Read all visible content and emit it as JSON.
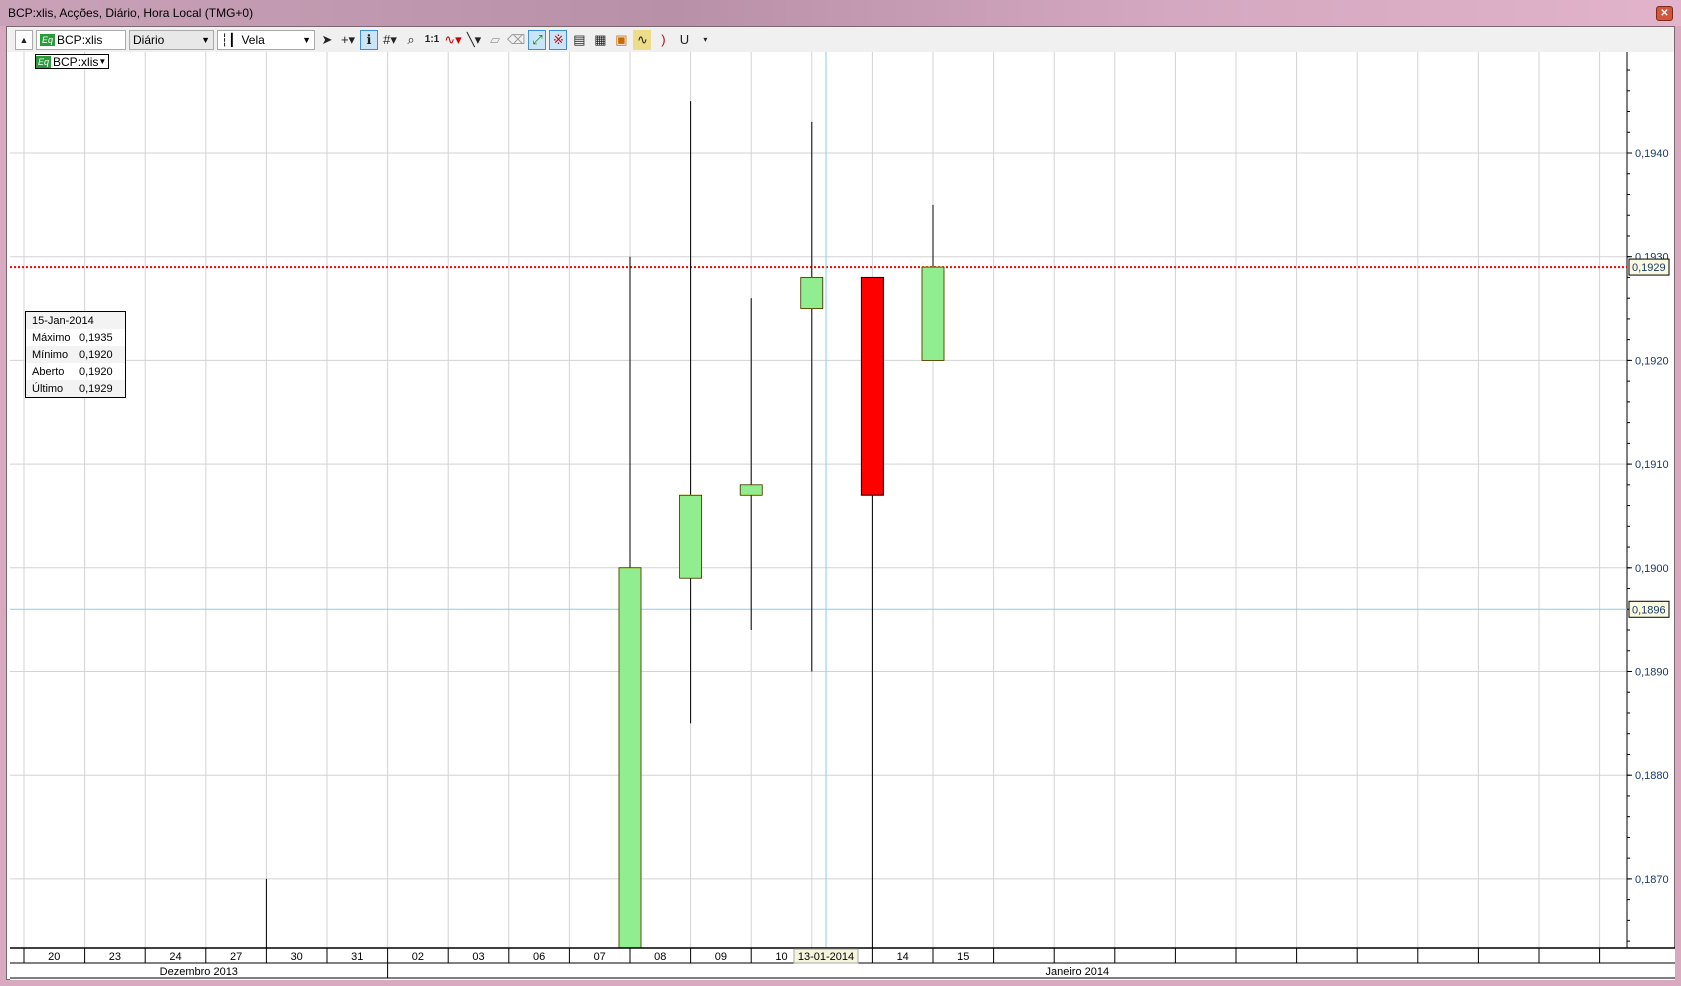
{
  "window": {
    "title": "BCP:xlis, Acções, Diário, Hora Local (TMG+0)",
    "close_icon": "close-icon"
  },
  "toolbar": {
    "symbol": "BCP:xlis",
    "symbol_badge": "Eq",
    "period": "Diário",
    "chart_type": "Vela"
  },
  "symbol_tag": "BCP:xlis",
  "info_box": {
    "date": "15-Jan-2014",
    "rows": [
      {
        "k": "Máximo",
        "v": "0,1935"
      },
      {
        "k": "Mínimo",
        "v": "0,1920"
      },
      {
        "k": "Aberto",
        "v": "0,1920"
      },
      {
        "k": "Último",
        "v": "0,1929"
      }
    ]
  },
  "chart_data": {
    "type": "candlestick",
    "ylim": [
      0.18633,
      0.19497
    ],
    "y_ticks": [
      "0,1940",
      "0,1930",
      "0,1920",
      "0,1910",
      "0,1900",
      "0,1890",
      "0,1880",
      "0,1870"
    ],
    "y_tick_values": [
      0.194,
      0.193,
      0.192,
      0.191,
      0.19,
      0.189,
      0.188,
      0.187
    ],
    "date_labels": [
      "20",
      "23",
      "24",
      "27",
      "30",
      "31",
      "02",
      "03",
      "06",
      "07",
      "08",
      "09",
      "10",
      "",
      "14",
      "15"
    ],
    "months": [
      "Dezembro 2013",
      "Janeiro 2014"
    ],
    "crosshair_date": "13-01-2014",
    "crosshair_price": "0,1896",
    "crosshair_price_value": 0.1896,
    "last_price": "0,1929",
    "last_price_value": 0.1929,
    "candles": [
      {
        "slot": 4,
        "open": 0.1862,
        "high": 0.187,
        "low": 0.186,
        "close": 0.1862
      },
      {
        "slot": 10,
        "open": 0.186,
        "high": 0.193,
        "low": 0.186,
        "close": 0.19
      },
      {
        "slot": 11,
        "open": 0.1899,
        "high": 0.1945,
        "low": 0.1885,
        "close": 0.1907
      },
      {
        "slot": 12,
        "open": 0.1907,
        "high": 0.1926,
        "low": 0.1894,
        "close": 0.1908
      },
      {
        "slot": 13,
        "open": 0.1925,
        "high": 0.1943,
        "low": 0.189,
        "close": 0.1928
      },
      {
        "slot": 14,
        "open": 0.1928,
        "high": 0.1928,
        "low": 0.186,
        "close": 0.1907
      },
      {
        "slot": 15,
        "open": 0.192,
        "high": 0.1935,
        "low": 0.192,
        "close": 0.1929
      }
    ],
    "colors": {
      "up": "#90ee90",
      "down": "#ff0000",
      "border": "#e8d000",
      "last": "#ff0000",
      "cross": "#87ceeb",
      "grid": "#d3d3d3"
    }
  }
}
